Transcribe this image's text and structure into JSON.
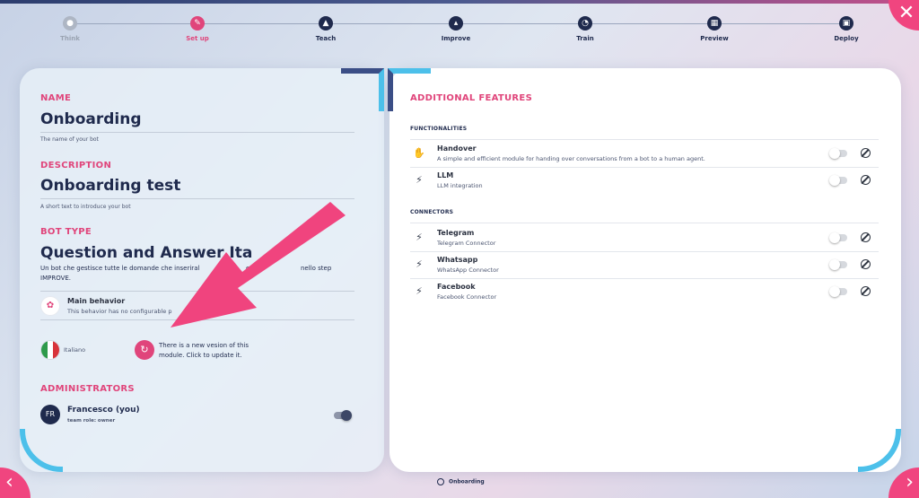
{
  "colors": {
    "accent": "#e0457b",
    "navy": "#1f2a4d",
    "cyan": "#4cc0ea"
  },
  "stepper": {
    "steps": [
      {
        "label": "Think",
        "icon": "bulb-icon",
        "state": "done"
      },
      {
        "label": "Set up",
        "icon": "pencil-icon",
        "state": "active"
      },
      {
        "label": "Teach",
        "icon": "graduation-cap-icon",
        "state": "pending"
      },
      {
        "label": "Improve",
        "icon": "chart-icon",
        "state": "pending"
      },
      {
        "label": "Train",
        "icon": "gauge-icon",
        "state": "pending"
      },
      {
        "label": "Preview",
        "icon": "calendar-icon",
        "state": "pending"
      },
      {
        "label": "Deploy",
        "icon": "deploy-icon",
        "state": "pending"
      }
    ]
  },
  "left": {
    "name_title": "NAME",
    "name_value": "Onboarding",
    "name_hint": "The name of your bot",
    "description_title": "DESCRIPTION",
    "description_value": "Onboarding test",
    "description_hint": "A short text to introduce your bot",
    "bot_type_title": "BOT TYPE",
    "bot_type_value": "Question and Answer Ita",
    "bot_type_desc": "Un bot che gestisce tutte le domande che inseriral",
    "bot_type_desc_mid": "e ad",
    "bot_type_desc_end": "nello step",
    "bot_type_desc_line2": "IMPROVE.",
    "behavior_name": "Main behavior",
    "behavior_desc": "This behavior has no configurable p",
    "language": "Italiano",
    "update_notice_line1": "There is a new vesion of this",
    "update_notice_line2": "module. Click to update it.",
    "administrators_title": "ADMINISTRATORS",
    "admin_initials": "FR",
    "admin_name": "Francesco (you)",
    "admin_role": "team role: owner"
  },
  "right": {
    "title": "ADDITIONAL FEATURES",
    "functionalities_title": "FUNCTIONALITIES",
    "connectors_title": "CONNECTORS",
    "functionalities": [
      {
        "name": "Handover",
        "desc": "A simple and efficient module for handing over conversations from a bot to a human agent.",
        "icon": "handshake-icon",
        "enabled": false
      },
      {
        "name": "LLM",
        "desc": "LLM integration",
        "icon": "plug-icon",
        "enabled": false
      }
    ],
    "connectors": [
      {
        "name": "Telegram",
        "desc": "Telegram Connector",
        "icon": "plug-icon",
        "enabled": false
      },
      {
        "name": "Whatsapp",
        "desc": "WhatsApp Connector",
        "icon": "plug-icon",
        "enabled": false
      },
      {
        "name": "Facebook",
        "desc": "Facebook Connector",
        "icon": "plug-icon",
        "enabled": false
      }
    ]
  },
  "footer": {
    "label": "Onboarding"
  }
}
